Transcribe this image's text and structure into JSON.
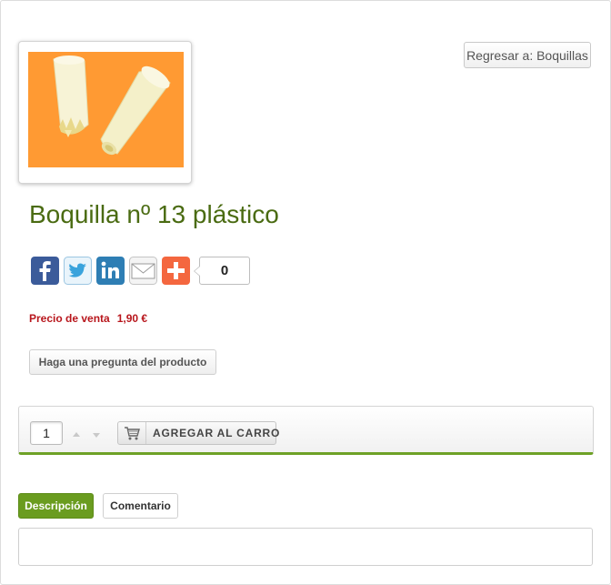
{
  "nav": {
    "back_label": "Regresar a: Boquillas"
  },
  "product": {
    "title": "Boquilla nº 13 plástico",
    "image_background": "#ff9a33"
  },
  "share": {
    "icons": [
      "facebook-icon",
      "twitter-icon",
      "linkedin-icon",
      "email-icon",
      "plus-icon"
    ],
    "count": "0"
  },
  "price": {
    "label": "Precio de venta",
    "value": "1,90 €",
    "color": "#b8161c"
  },
  "ask_question": {
    "label": "Haga una pregunta del producto"
  },
  "cart": {
    "quantity": "1",
    "add_label": "AGREGAR AL CARRO",
    "accent": "#6ea126"
  },
  "tabs": [
    {
      "label": "Descripción",
      "active": true
    },
    {
      "label": "Comentario",
      "active": false
    }
  ],
  "colors": {
    "title": "#4a6b12",
    "tab_active": "#6a9c1f"
  }
}
